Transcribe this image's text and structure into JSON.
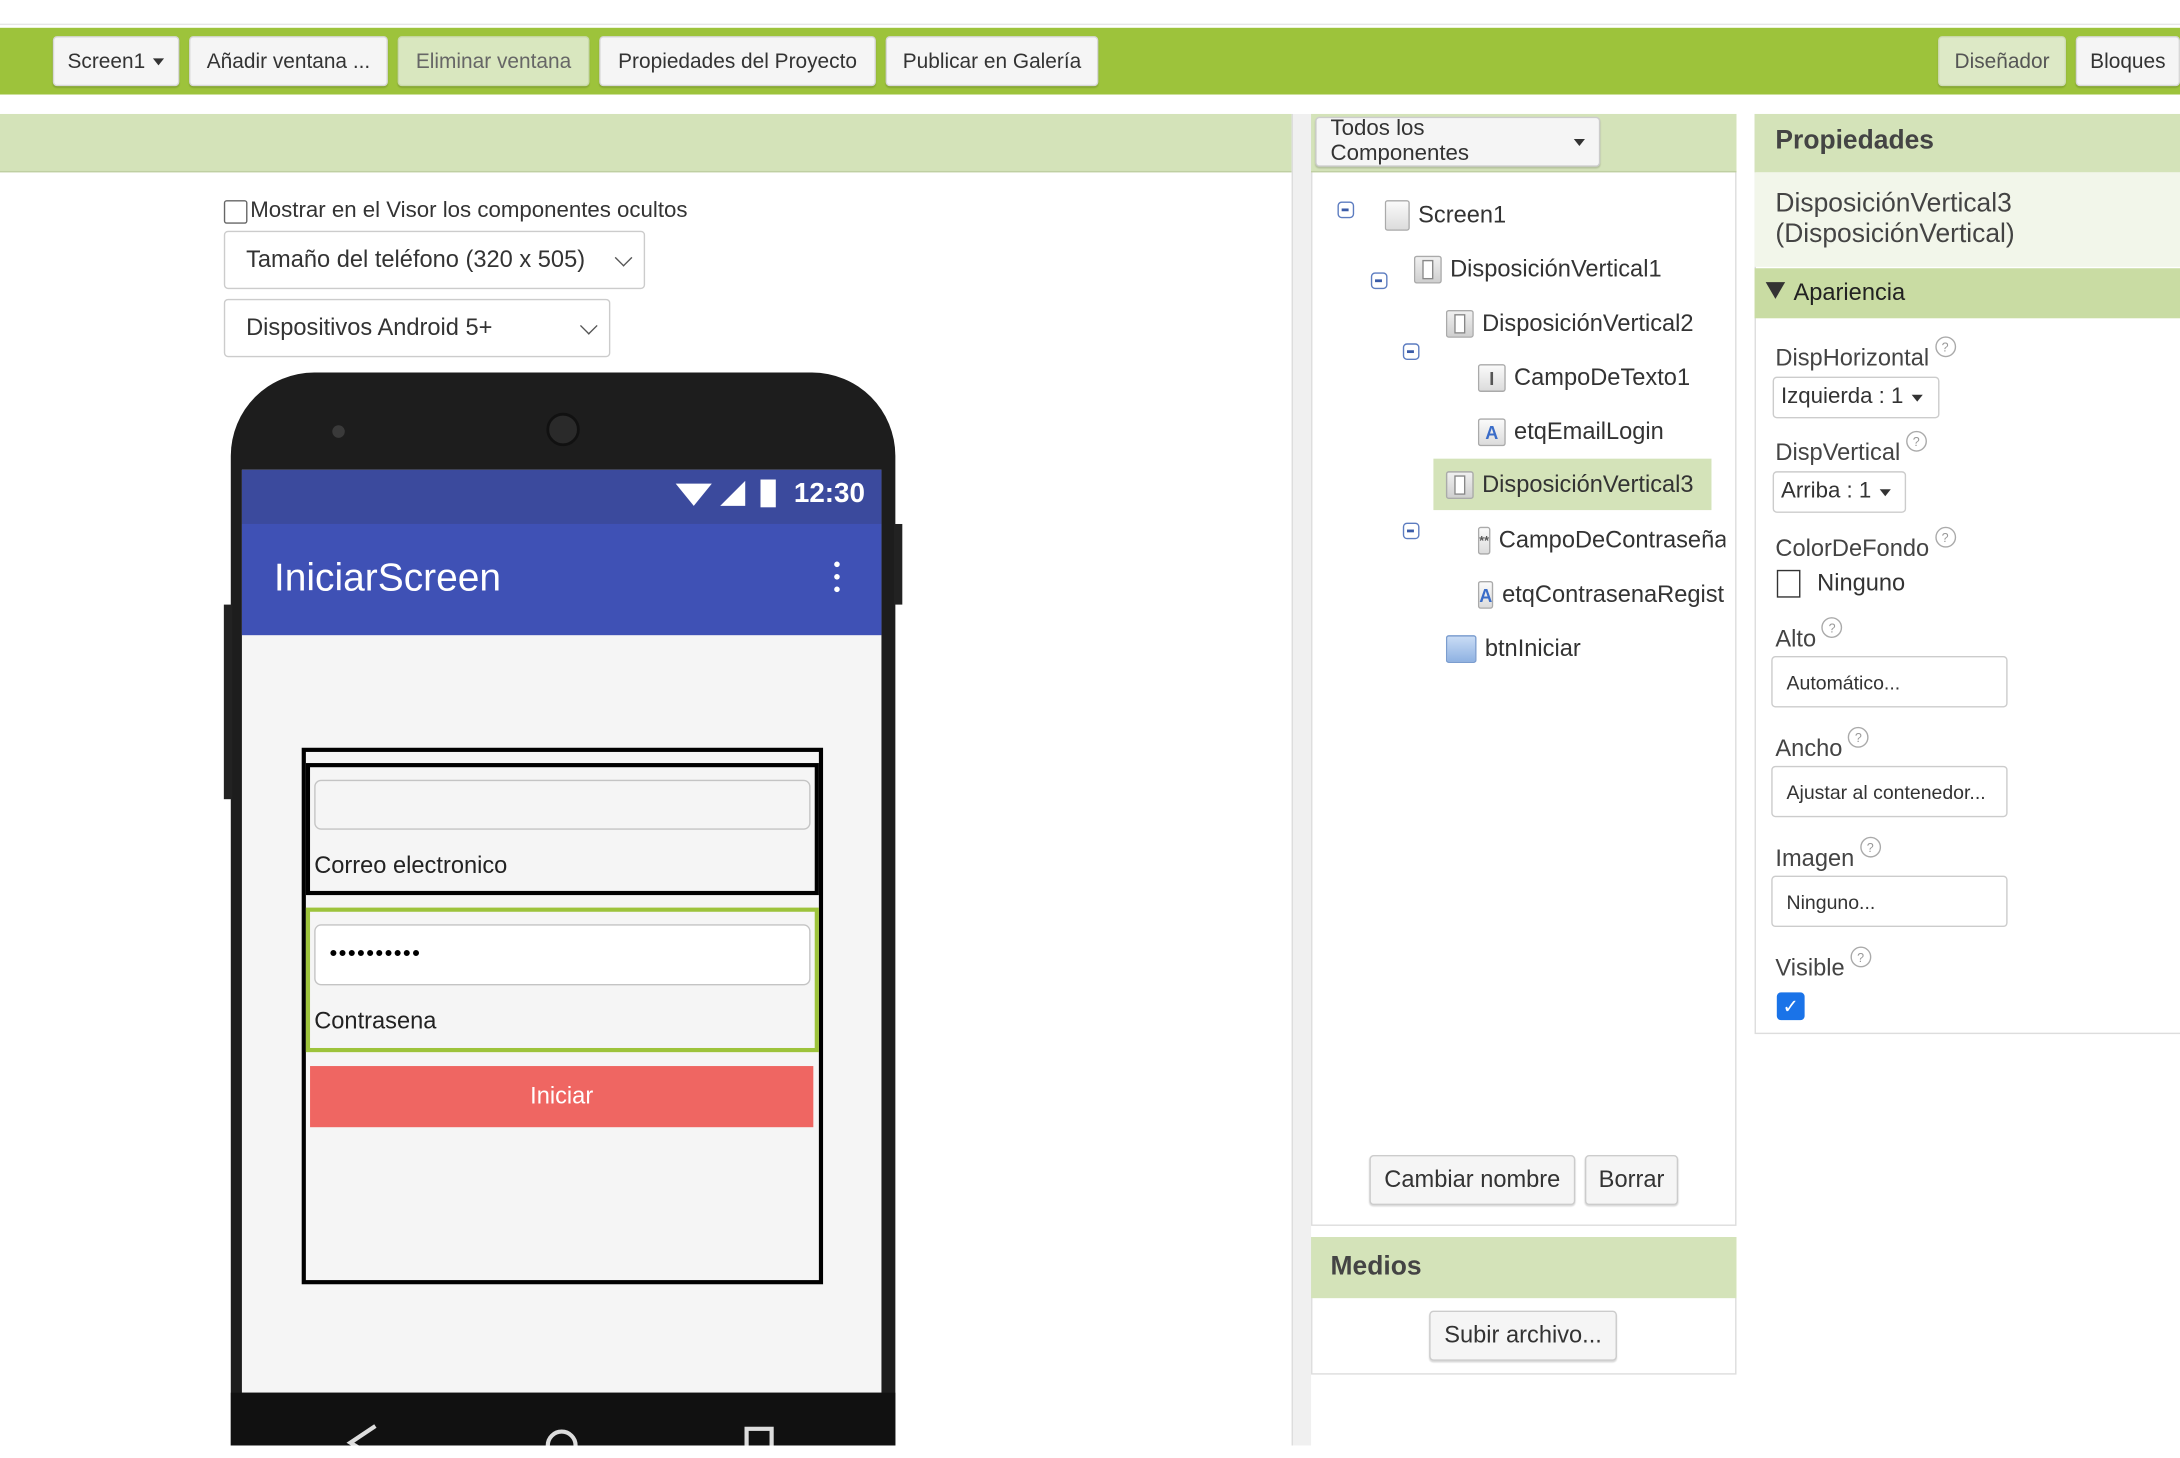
{
  "toolbar": {
    "screen_label": "Screen1",
    "add_window": "Añadir ventana ...",
    "remove_window": "Eliminar ventana",
    "project_props": "Propiedades del Proyecto",
    "publish": "Publicar en Galería",
    "designer": "Diseñador",
    "blocks": "Bloques"
  },
  "viewer": {
    "show_hidden": "Mostrar en el Visor los componentes ocultos",
    "phone_size": "Tamaño del teléfono (320 x 505)",
    "devices": "Dispositivos Android 5+"
  },
  "phone": {
    "time": "12:30",
    "title": "IniciarScreen",
    "email_label": "Correo electronico",
    "password_value": "••••••••••",
    "password_label": "Contrasena",
    "button": "Iniciar"
  },
  "components": {
    "filter": "Todos los Componentes",
    "tree": [
      {
        "label": "Screen1",
        "icon": "screen-icon"
      },
      {
        "label": "DisposiciónVertical1",
        "icon": "vertical-arrangement-icon"
      },
      {
        "label": "DisposiciónVertical2",
        "icon": "vertical-arrangement-icon"
      },
      {
        "label": "CampoDeTexto1",
        "icon": "textbox-icon"
      },
      {
        "label": "etqEmailLogin",
        "icon": "label-icon"
      },
      {
        "label": "DisposiciónVertical3",
        "icon": "vertical-arrangement-icon"
      },
      {
        "label": "CampoDeContraseña",
        "icon": "password-icon"
      },
      {
        "label": "etqContrasenaRegistro",
        "icon": "label-icon"
      },
      {
        "label": "btnIniciar",
        "icon": "button-icon"
      }
    ],
    "rename": "Cambiar nombre",
    "delete": "Borrar"
  },
  "media": {
    "title": "Medios",
    "upload": "Subir archivo..."
  },
  "properties": {
    "title": "Propiedades",
    "component": "DisposiciónVertical3\n(DisposiciónVertical)",
    "section": "Apariencia",
    "disp_horizontal_label": "DispHorizontal",
    "disp_horizontal_value": "Izquierda : 1",
    "disp_vertical_label": "DispVertical",
    "disp_vertical_value": "Arriba : 1",
    "bg_color_label": "ColorDeFondo",
    "bg_color_value": "Ninguno",
    "height_label": "Alto",
    "height_value": "Automático...",
    "width_label": "Ancho",
    "width_value": "Ajustar al contenedor...",
    "image_label": "Imagen",
    "image_value": "Ninguno...",
    "visible_label": "Visible",
    "visible_checked": true
  },
  "colors": {
    "toolbar": "#9dc33b",
    "panel_header": "#d4e3b9",
    "app_bar": "#3f51b5",
    "status_bar": "#3b4a9d",
    "button": "#ef6662"
  }
}
